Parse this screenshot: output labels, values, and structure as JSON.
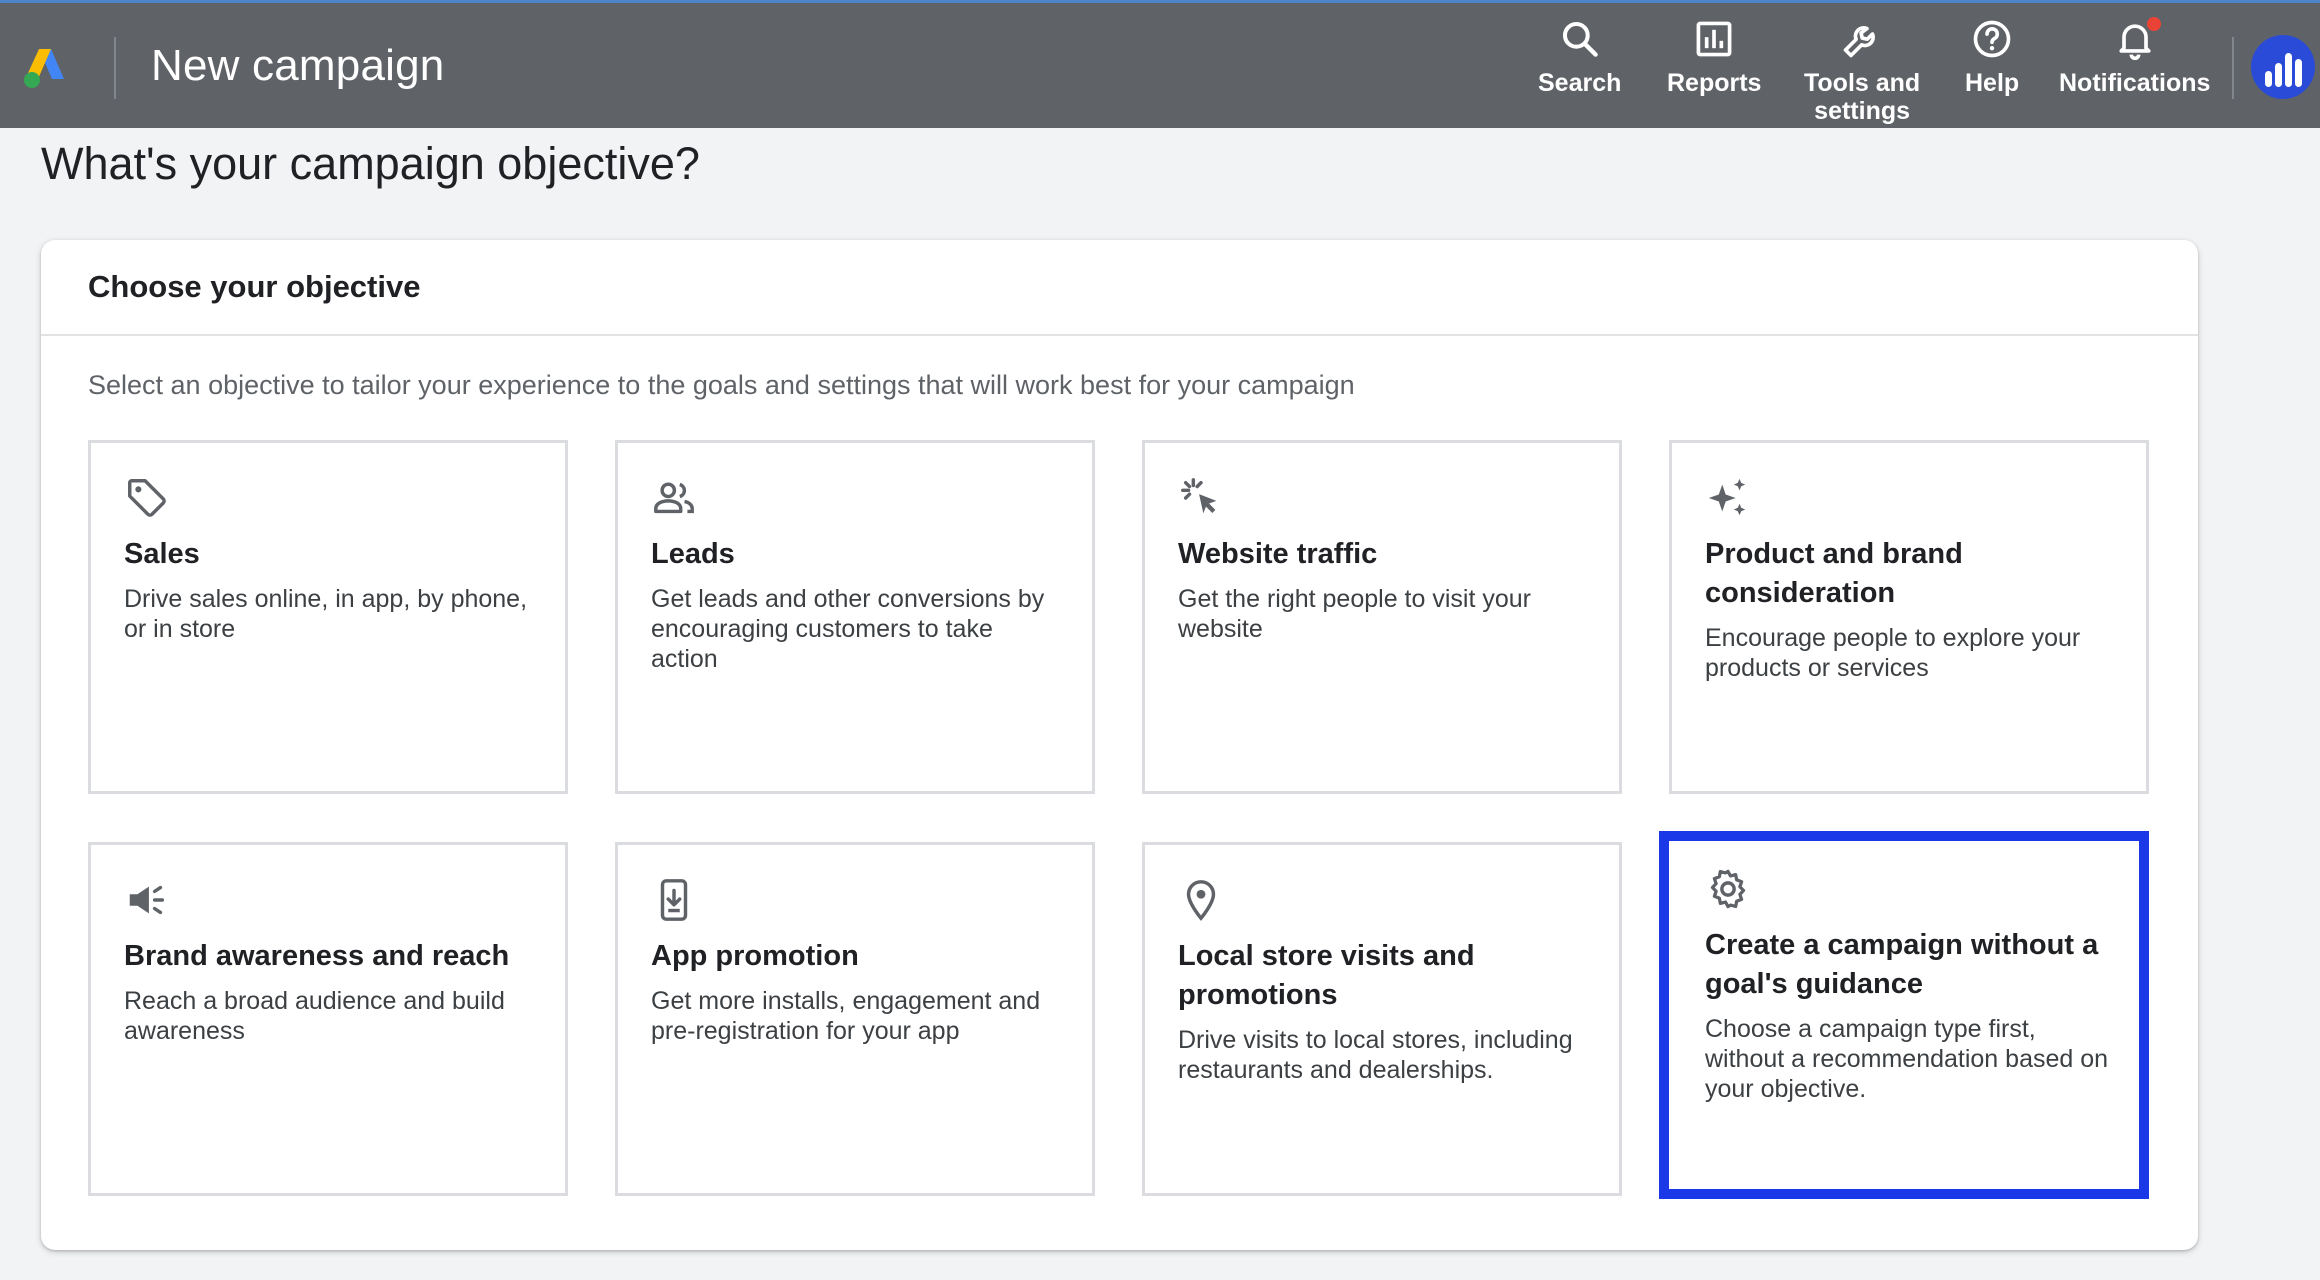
{
  "header": {
    "title": "New campaign",
    "logo": "google-ads-logo",
    "nav": [
      {
        "id": "search",
        "label": "Search",
        "icon": "search-icon"
      },
      {
        "id": "reports",
        "label": "Reports",
        "icon": "bar-chart-icon"
      },
      {
        "id": "tools",
        "label": "Tools and\nsettings",
        "icon": "wrench-icon"
      },
      {
        "id": "help",
        "label": "Help",
        "icon": "help-circle-icon"
      },
      {
        "id": "notifications",
        "label": "Notifications",
        "icon": "bell-icon"
      }
    ],
    "avatar_icon": "profile-avatar-bars",
    "bar_color": "#5f6368",
    "notification_dot_color": "#ea4335"
  },
  "page": {
    "title": "What's your campaign objective?"
  },
  "panel": {
    "title": "Choose your objective",
    "description": "Select an objective to tailor your experience to the goals and settings that will work best for your campaign",
    "objectives": [
      {
        "title": "Sales",
        "description": "Drive sales online, in app, by phone, or in store",
        "icon": "tag-icon",
        "selected": false
      },
      {
        "title": "Leads",
        "description": "Get leads and other conversions by encouraging customers to take action",
        "icon": "people-icon",
        "selected": false
      },
      {
        "title": "Website traffic",
        "description": "Get the right people to visit your website",
        "icon": "cursor-click-icon",
        "selected": false
      },
      {
        "title": "Product and brand consideration",
        "description": "Encourage people to explore your products or services",
        "icon": "sparkle-icon",
        "selected": false
      },
      {
        "title": "Brand awareness and reach",
        "description": "Reach a broad audience and build awareness",
        "icon": "megaphone-icon",
        "selected": false
      },
      {
        "title": "App promotion",
        "description": "Get more installs, engagement and pre-registration for your app",
        "icon": "phone-download-icon",
        "selected": false
      },
      {
        "title": "Local store visits and promotions",
        "description": "Drive visits to local stores, including restaurants and dealerships.",
        "icon": "location-pin-icon",
        "selected": false
      },
      {
        "title": "Create a campaign without a goal's guidance",
        "description": "Choose a campaign type first, without a recommendation based on your objective.",
        "icon": "gear-icon",
        "selected": true
      }
    ],
    "selected_color": "#1a37e8"
  }
}
